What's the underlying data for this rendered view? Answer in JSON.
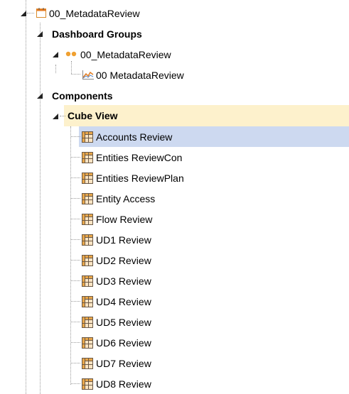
{
  "root": {
    "label": "00_MetadataReview",
    "icon": "calendar-icon"
  },
  "dashboard_groups": {
    "label": "Dashboard Groups",
    "group": {
      "label": "00_MetadataReview",
      "icon": "dashboard-group-icon"
    },
    "dashboard": {
      "label": "00 MetadataReview",
      "icon": "chart-icon"
    }
  },
  "components": {
    "label": "Components",
    "cube_view": {
      "label": "Cube View",
      "items": [
        {
          "label": "Accounts Review"
        },
        {
          "label": "Entities ReviewCon"
        },
        {
          "label": "Entities ReviewPlan"
        },
        {
          "label": "Entity Access"
        },
        {
          "label": "Flow Review"
        },
        {
          "label": "UD1 Review"
        },
        {
          "label": "UD2 Review"
        },
        {
          "label": "UD3 Review"
        },
        {
          "label": "UD4 Review"
        },
        {
          "label": "UD5 Review"
        },
        {
          "label": "UD6 Review"
        },
        {
          "label": "UD7 Review"
        },
        {
          "label": "UD8 Review"
        }
      ]
    }
  },
  "colors": {
    "selected_item_bg": "#cdd9f0",
    "highlighted_folder_bg": "#fdf1cc",
    "grid_icon_orange": "#e8a64a",
    "dot_orange": "#f0a030"
  }
}
